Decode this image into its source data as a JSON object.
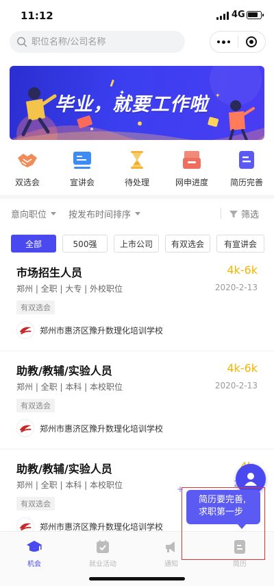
{
  "status_bar": {
    "time": "11:12",
    "network": "4G"
  },
  "search": {
    "placeholder": "职位名称/公司名称"
  },
  "banner": {
    "title": "毕业，就要工作啦"
  },
  "quick_actions": [
    {
      "label": "双选会",
      "icon": "handshake-icon"
    },
    {
      "label": "宣讲会",
      "icon": "presentation-board-icon"
    },
    {
      "label": "待处理",
      "icon": "hourglass-icon"
    },
    {
      "label": "网申进度",
      "icon": "inbox-progress-icon"
    },
    {
      "label": "简历完善",
      "icon": "resume-icon"
    }
  ],
  "filters": {
    "intent": "意向职位",
    "sort": "按发布时间排序",
    "filter": "筛选"
  },
  "chips": [
    "全部",
    "500强",
    "上市公司",
    "有双选会",
    "有宣讲会"
  ],
  "jobs": [
    {
      "title": "市场招生人员",
      "salary": "4k-6k",
      "meta": "郑州 | 全职 | 大专 | 外校职位",
      "date": "2020-2-13",
      "tag": "有双选会",
      "company": "郑州市惠济区豫升数理化培训学校"
    },
    {
      "title": "助教/教辅/实验人员",
      "salary": "4k-6k",
      "meta": "郑州 | 全职 | 本科 | 本校职位",
      "date": "2020-2-13",
      "tag": "有双选会",
      "company": "郑州市惠济区豫升数理化培训学校"
    },
    {
      "title": "助教/教辅/实验人员",
      "salary": "4k-",
      "meta": "郑州 | 全职 | 本科 | 本校职位",
      "date": "2020-",
      "tag": "有双选会",
      "company": "郑州市惠济区豫升数理化培训学校"
    }
  ],
  "tooltip": {
    "line1": "简历要完善,",
    "line2": "求职第一步"
  },
  "tabs": [
    {
      "label": "机会",
      "icon": "graduation-cap-icon",
      "active": true
    },
    {
      "label": "就业活动",
      "icon": "calendar-check-icon",
      "active": false
    },
    {
      "label": "通知",
      "icon": "megaphone-icon",
      "active": false
    },
    {
      "label": "简历",
      "icon": "resume-icon",
      "active": false
    }
  ],
  "colors": {
    "accent": "#4a49f0",
    "salary": "#f5b400",
    "highlight": "#e23232"
  }
}
